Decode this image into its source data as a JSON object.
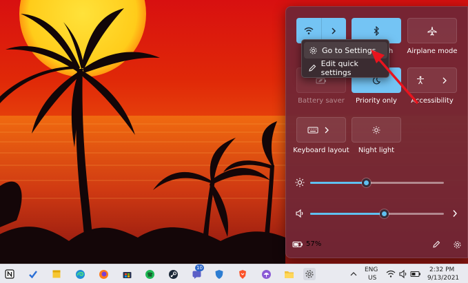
{
  "quick_settings": {
    "tiles": [
      {
        "id": "wifi",
        "label": "",
        "state": "on",
        "icon": "wifi-icon"
      },
      {
        "id": "bluetooth",
        "label": "Bluetooth",
        "state": "on",
        "icon": "bluetooth-icon"
      },
      {
        "id": "airplane",
        "label": "Airplane mode",
        "state": "off",
        "icon": "airplane-icon"
      },
      {
        "id": "battery_saver",
        "label": "Battery saver",
        "state": "disabled",
        "icon": "battery-leaf-icon"
      },
      {
        "id": "priority",
        "label": "Priority only",
        "state": "on",
        "icon": "moon-icon"
      },
      {
        "id": "accessibility",
        "label": "Accessibility",
        "state": "off",
        "icon": "accessibility-icon"
      },
      {
        "id": "keyboard",
        "label": "Keyboard layout",
        "state": "off",
        "icon": "keyboard-icon"
      },
      {
        "id": "night_light",
        "label": "Night light",
        "state": "off",
        "icon": "night-light-icon"
      }
    ],
    "brightness": {
      "level": 0.42,
      "icon": "sun-icon"
    },
    "volume": {
      "level": 0.55,
      "icon": "speaker-icon"
    },
    "battery_percent": "57%",
    "footer_icons": [
      "pencil-icon",
      "gear-icon"
    ]
  },
  "context_menu": {
    "items": [
      {
        "label": "Go to Settings",
        "icon": "gear-icon"
      },
      {
        "label": "Edit quick settings",
        "icon": "pencil-icon"
      }
    ]
  },
  "taskbar": {
    "apps": [
      "notion-icon",
      "tasks-icon",
      "sticky-notes-icon",
      "edge-icon",
      "firefox-icon",
      "store-icon",
      "spotify-icon",
      "steam-icon",
      "chat-icon",
      "windows-security-icon",
      "brave-icon",
      "umbrella-icon",
      "file-explorer-icon",
      "settings-icon"
    ],
    "chat_badge": "10",
    "language_line1": "ENG",
    "language_line2": "US",
    "time": "2:32 PM",
    "date": "9/13/2021"
  },
  "colors": {
    "accent": "#74c4f4",
    "panel": "#6e2636",
    "annotation_arrow": "#e8141e"
  }
}
